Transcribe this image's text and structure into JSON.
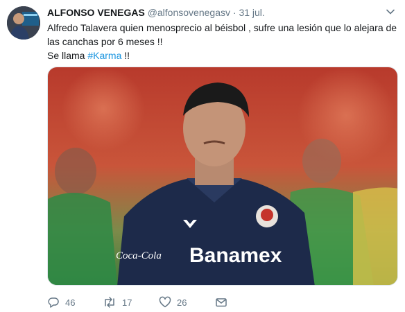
{
  "tweet": {
    "display_name": "ALFONSO VENEGAS",
    "handle": "@alfonsovenegasv",
    "separator": "·",
    "date": "31 jul.",
    "text_line1": "Alfredo Talavera quien menosprecio al béisbol , sufre una lesión que lo alejara de las canchas por 6 meses !!",
    "text_line2_prefix": "Se llama ",
    "hashtag": "#Karma",
    "text_line2_suffix": " !!",
    "jersey_sponsor": "Banamex",
    "jersey_brand": "Coca-Cola",
    "colors": {
      "hashtag": "#1b95e0",
      "meta": "#657786",
      "jersey": "#1d2a4a"
    }
  },
  "actions": {
    "reply_count": "46",
    "retweet_count": "17",
    "like_count": "26",
    "icons": [
      "reply-icon",
      "retweet-icon",
      "like-icon",
      "message-icon"
    ]
  }
}
